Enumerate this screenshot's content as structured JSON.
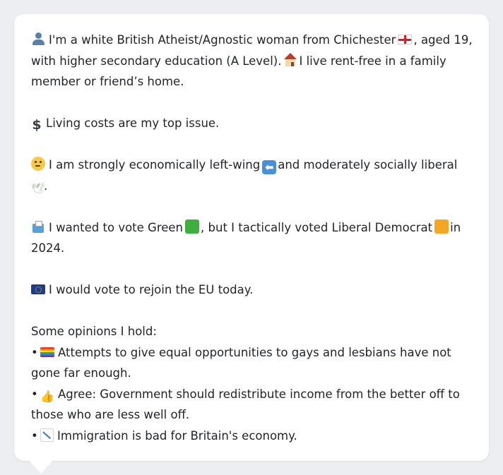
{
  "profile": {
    "intro": {
      "line1_a": "I'm a white British Atheist/Agnostic woman from Chichester",
      "line1_b": ", aged 19,",
      "line2_a": "with higher secondary education (A Level).",
      "line2_b": "I live rent-free in a family",
      "line3": "member or friend’s home."
    },
    "issue": "Living costs are my top issue.",
    "ideology": {
      "line1_a": "I am strongly economically left-wing",
      "line1_b": "and moderately socially liberal",
      "line2_b": "."
    },
    "vote": {
      "line1_a": "I wanted to vote Green",
      "line1_b": ", but I tactically voted Liberal Democrat",
      "line1_c": "in",
      "line2": "2024."
    },
    "eu": "I would vote to rejoin the EU today.",
    "opinions": {
      "heading": "Some opinions I hold:",
      "bullet": "•",
      "items": [
        {
          "icon": "rainbow-flag-icon",
          "line1": "Attempts to give equal opportunities to gays and lesbians have not",
          "line2": "gone far enough."
        },
        {
          "icon": "thumbs-up-icon",
          "line1": "Agree: Government should redistribute income from the better off to",
          "line2": "those who are less well off."
        },
        {
          "icon": "chart-down-icon",
          "line1": "Immigration is bad for Britain's economy."
        }
      ]
    }
  },
  "icons": {
    "dollar": "$",
    "left_arrow": "⬅",
    "dove": "🕊",
    "thumbs_up": "👍"
  },
  "colors": {
    "background": "#eceef2",
    "bubble": "#ffffff",
    "text": "#1f2328",
    "green_square": "#3fae3f",
    "orange_square": "#f5a623",
    "flag_red": "#d6202b",
    "eu_blue": "#1f3c8a"
  }
}
